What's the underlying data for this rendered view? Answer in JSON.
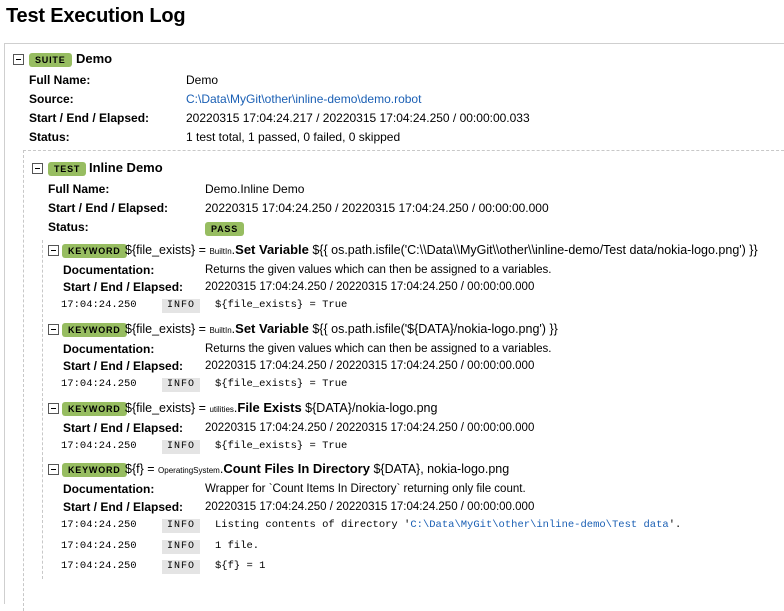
{
  "page": {
    "title": "Test Execution Log"
  },
  "suite": {
    "badge": "SUITE",
    "name": "Demo",
    "labels": {
      "full_name": "Full Name:",
      "source": "Source:",
      "times": "Start / End / Elapsed:",
      "status": "Status:"
    },
    "full_name": "Demo",
    "source": "C:\\Data\\MyGit\\other\\inline-demo\\demo.robot",
    "times": "20220315 17:04:24.217 / 20220315 17:04:24.250 / 00:00:00.033",
    "status": "1 test total, 1 passed, 0 failed, 0 skipped"
  },
  "test": {
    "badge": "TEST",
    "name": "Inline Demo",
    "labels": {
      "full_name": "Full Name:",
      "times": "Start / End / Elapsed:",
      "status": "Status:"
    },
    "full_name": "Demo.Inline Demo",
    "times": "20220315 17:04:24.250 / 20220315 17:04:24.250 / 00:00:00.000",
    "status": "PASS"
  },
  "keywords": [
    {
      "badge": "KEYWORD",
      "assign": "${file_exists} = ",
      "library": "BuiltIn",
      "name": "Set Variable",
      "args": " ${{ os.path.isfile('C:\\\\Data\\\\MyGit\\\\other\\\\inline-demo/Test data/nokia-logo.png') }}",
      "doc_label": "Documentation:",
      "doc": "Returns the given values which can then be assigned to a variables.",
      "times_label": "Start / End / Elapsed:",
      "times": "20220315 17:04:24.250 / 20220315 17:04:24.250 / 00:00:00.000",
      "messages": [
        {
          "time": "17:04:24.250",
          "level": "INFO",
          "text": "${file_exists} = True"
        }
      ]
    },
    {
      "badge": "KEYWORD",
      "assign": "${file_exists} = ",
      "library": "BuiltIn",
      "name": "Set Variable",
      "args": " ${{ os.path.isfile('${DATA}/nokia-logo.png') }}",
      "doc_label": "Documentation:",
      "doc": "Returns the given values which can then be assigned to a variables.",
      "times_label": "Start / End / Elapsed:",
      "times": "20220315 17:04:24.250 / 20220315 17:04:24.250 / 00:00:00.000",
      "messages": [
        {
          "time": "17:04:24.250",
          "level": "INFO",
          "text": "${file_exists} = True"
        }
      ]
    },
    {
      "badge": "KEYWORD",
      "assign": "${file_exists} = ",
      "library": "utilities",
      "name": "File Exists",
      "args": " ${DATA}/nokia-logo.png",
      "times_label": "Start / End / Elapsed:",
      "times": "20220315 17:04:24.250 / 20220315 17:04:24.250 / 00:00:00.000",
      "messages": [
        {
          "time": "17:04:24.250",
          "level": "INFO",
          "text": "${file_exists} = True"
        }
      ]
    },
    {
      "badge": "KEYWORD",
      "assign": "${f} = ",
      "library": "OperatingSystem",
      "name": "Count Files In Directory",
      "args": " ${DATA}, nokia-logo.png",
      "doc_label": "Documentation:",
      "doc": "Wrapper for `Count Items In Directory` returning only file count.",
      "times_label": "Start / End / Elapsed:",
      "times": "20220315 17:04:24.250 / 20220315 17:04:24.250 / 00:00:00.000",
      "messages": [
        {
          "time": "17:04:24.250",
          "level": "INFO",
          "text_prefix": "Listing contents of directory '",
          "link": "C:\\Data\\MyGit\\other\\inline-demo\\Test data",
          "text_suffix": "'."
        },
        {
          "time": "17:04:24.250",
          "level": "INFO",
          "text": "1 file."
        },
        {
          "time": "17:04:24.250",
          "level": "INFO",
          "text": "${f} = 1"
        }
      ]
    }
  ]
}
